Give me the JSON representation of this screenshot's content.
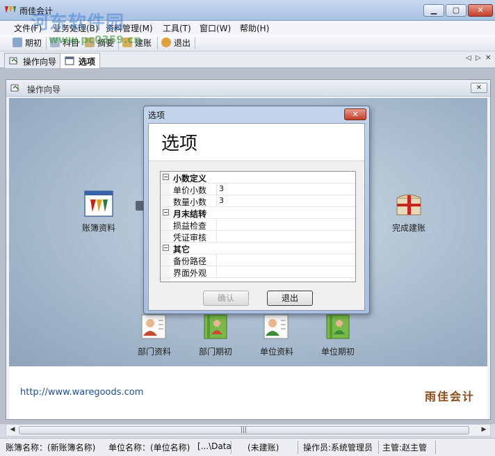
{
  "app": {
    "title": "雨佳会计"
  },
  "watermark": {
    "text": "河东软件园",
    "url": "www.pc0359.cn"
  },
  "menu": [
    "文件(F)",
    "业务处理(B)",
    "资料管理(M)",
    "工具(T)",
    "窗口(W)",
    "帮助(H)"
  ],
  "toolbar": [
    "期初",
    "科目",
    "摘要",
    "建账",
    "退出"
  ],
  "tabs": [
    "操作向导",
    "选项"
  ],
  "inner_window": {
    "title": "操作向导"
  },
  "flow": {
    "items": [
      "账簿资料",
      "完成建账",
      "部门资料",
      "部门期初",
      "单位资料",
      "单位期初"
    ]
  },
  "footer": {
    "url": "http://www.waregoods.com",
    "brand": "雨佳会计"
  },
  "statusbar": {
    "book": "账簿名称：(新账簿名称)",
    "unit": "单位名称：(单位名称)",
    "path": "[...\\Data",
    "state": "(未建账)",
    "operator": "操作员:系统管理员",
    "supervisor": "主管:赵主管"
  },
  "dialog": {
    "title": "选项",
    "heading": "选项",
    "categories": [
      {
        "name": "小数定义",
        "props": [
          {
            "name": "单价小数",
            "value": "3"
          },
          {
            "name": "数量小数",
            "value": "3"
          }
        ]
      },
      {
        "name": "月末结转",
        "props": [
          {
            "name": "损益检查",
            "value": ""
          },
          {
            "name": "凭证审核",
            "value": ""
          }
        ]
      },
      {
        "name": "其它",
        "props": [
          {
            "name": "备份路径",
            "value": ""
          },
          {
            "name": "界面外观",
            "value": ""
          }
        ]
      }
    ],
    "ok_label": "确认",
    "exit_label": "退出"
  },
  "icons": {
    "app": "logo-icon",
    "guide": "wizard-icon",
    "options": "window-icon"
  }
}
